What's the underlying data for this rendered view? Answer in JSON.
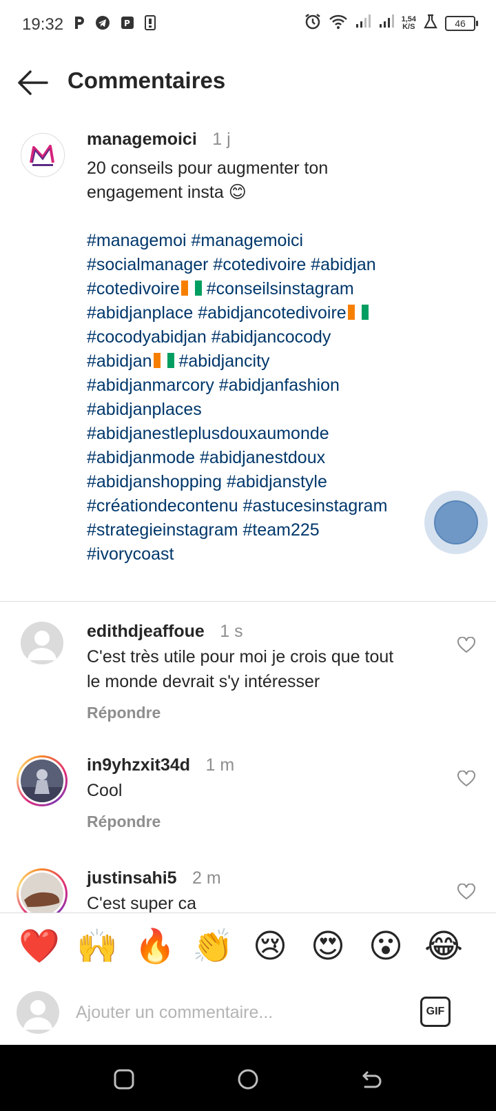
{
  "status_bar": {
    "time": "19:32",
    "net_speed_value": "1,54",
    "net_speed_unit": "K/S",
    "battery": "46",
    "icons_left": [
      "parking-app-icon",
      "telegram-icon",
      "pp-app-icon",
      "sim-card-icon"
    ],
    "icons_right": [
      "alarm-icon",
      "wifi-icon",
      "signal-icon",
      "signal-icon",
      "lab-flask-icon",
      "battery-icon"
    ]
  },
  "header": {
    "title": "Commentaires"
  },
  "caption": {
    "username": "managemoici",
    "time": "1 j",
    "text_line1": "20 conseils pour augmenter ton",
    "text_line2": "engagement insta 😊",
    "hashtags": {
      "l1": "#managemoi #managemoici",
      "l2": "#socialmanager #cotedivoire #abidjan",
      "l3a": "#cotedivoire",
      "l3b": " #conseilsinstagram",
      "l4": "#abidjanplace #abidjancotedivoire",
      "l5": "#cocodyabidjan #abidjancocody",
      "l6a": "#abidjan",
      "l6b": " #abidjancity",
      "l7": "#abidjanmarcory #abidjanfashion",
      "l8": "#abidjanplaces",
      "l9": "#abidjanestleplusdouxaumonde",
      "l10": "#abidjanmode #abidjanestdoux",
      "l11": "#abidjanshopping #abidjanstyle",
      "l12": "#créationdecontenu #astucesinstagram",
      "l13": "#strategieinstagram #team225",
      "l14": "#ivorycoast"
    },
    "flag_colors": [
      "#f77f00",
      "#ffffff",
      "#009e60"
    ]
  },
  "comments": [
    {
      "username": "edithdjeaffoue",
      "time": "1 s",
      "text_line1": "C'est très utile pour moi je crois que tout",
      "text_line2": "le monde devrait s'y intéresser",
      "reply": "Répondre"
    },
    {
      "username": "in9yhzxit34d",
      "time": "1 m",
      "text_line1": "Cool",
      "reply": "Répondre"
    },
    {
      "username": "justinsahi5",
      "time": "2 m",
      "text_line1": "C'est super ca"
    }
  ],
  "emoji_bar": {
    "emojis": [
      "❤️",
      "🙌",
      "🔥",
      "👏",
      "😢",
      "😍",
      "😮",
      "😂"
    ]
  },
  "comment_input": {
    "placeholder": "Ajouter un commentaire...",
    "gif_label": "GIF"
  },
  "colors": {
    "hashtag": "#00376b",
    "text": "#262626",
    "muted": "#8e8e8e"
  }
}
